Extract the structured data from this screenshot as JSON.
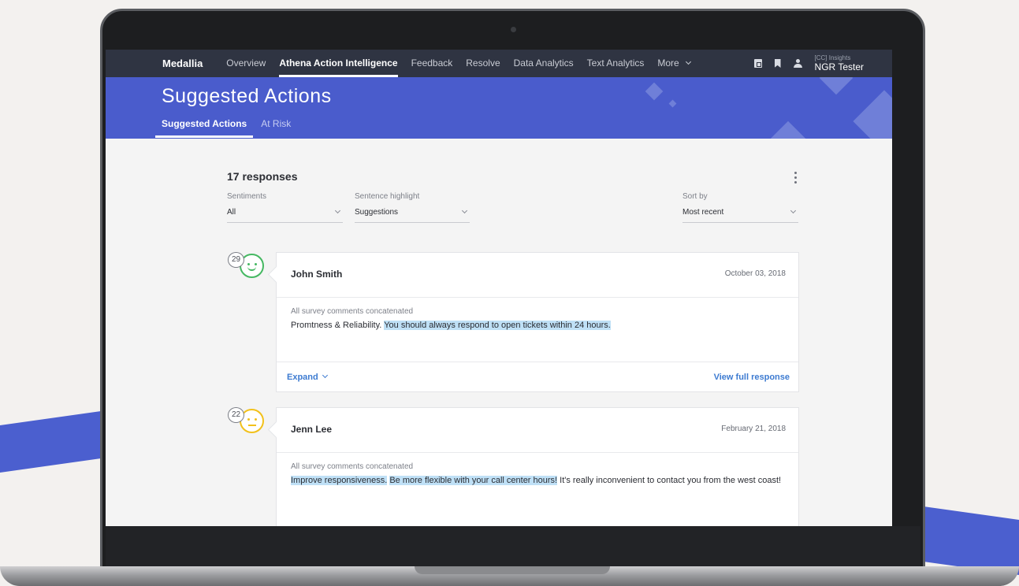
{
  "nav": {
    "brand": "Medallia",
    "items": [
      "Overview",
      "Athena Action Intelligence",
      "Feedback",
      "Resolve",
      "Data Analytics",
      "Text Analytics",
      "More"
    ],
    "active_index": 1,
    "user_sub": "[CC] Insights",
    "user_name": "NGR Tester"
  },
  "header": {
    "title": "Suggested Actions",
    "tabs": [
      "Suggested Actions",
      "At Risk"
    ],
    "active_tab": 0
  },
  "toolbar": {
    "count_label": "17 responses",
    "filters": [
      {
        "label": "Sentiments",
        "value": "All"
      },
      {
        "label": "Sentence highlight",
        "value": "Suggestions"
      },
      {
        "label": "Sort by",
        "value": "Most recent"
      }
    ]
  },
  "responses": [
    {
      "score": "29",
      "sentiment": "positive",
      "name": "John Smith",
      "date": "October 03, 2018",
      "body_label": "All survey comments concatenated",
      "text_plain": "Promtness & Reliability. ",
      "text_highlight": "You should always respond to open tickets within 24 hours.",
      "text_rest": "",
      "expand_label": "Expand",
      "view_label": "View full response"
    },
    {
      "score": "22",
      "sentiment": "neutral",
      "name": "Jenn Lee",
      "date": "February 21, 2018",
      "body_label": "All survey comments concatenated",
      "text_highlight_1": "Improve responsiveness.",
      "text_highlight_2": "Be more flexible with your call center hours!",
      "text_rest": " It's really inconvenient to contact you from the west coast!"
    }
  ],
  "colors": {
    "nav_bg": "#2f3442",
    "hero_bg": "#4a5ccc",
    "positive": "#45b862",
    "neutral": "#f2c11b",
    "link": "#3d7bd1",
    "highlight": "#bfe0f6"
  }
}
